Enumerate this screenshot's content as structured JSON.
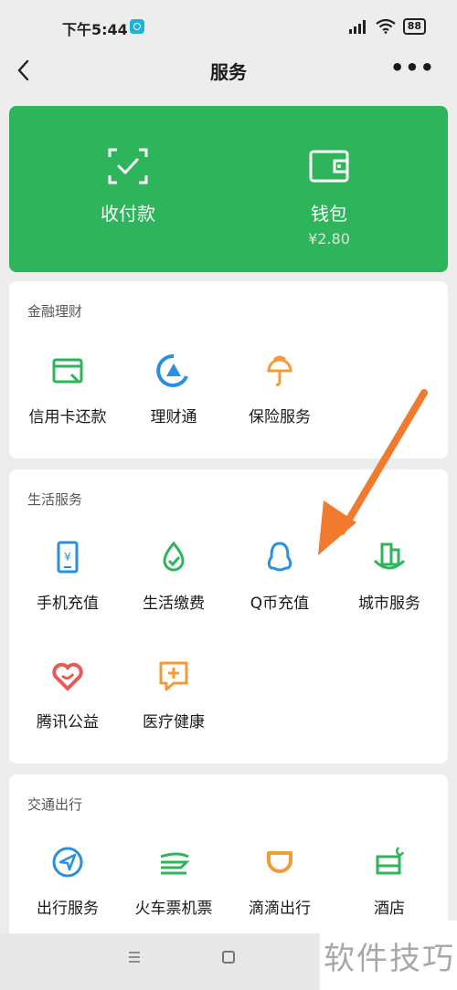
{
  "status_bar": {
    "time": "下午5:44",
    "signal_badge": "HD",
    "battery": "88"
  },
  "header": {
    "title": "服务",
    "more": "•••"
  },
  "wallet_card": {
    "pay_label": "收付款",
    "wallet_label": "钱包",
    "balance": "¥2.80",
    "bg_color": "#2eb45a"
  },
  "sections": {
    "finance": {
      "title": "金融理财",
      "items": [
        {
          "label": "信用卡还款",
          "icon": "credit-card-icon",
          "color": "#2eb45a"
        },
        {
          "label": "理财通",
          "icon": "wealth-icon",
          "color": "#2a8fe0"
        },
        {
          "label": "保险服务",
          "icon": "insurance-icon",
          "color": "#f29b38"
        }
      ]
    },
    "life": {
      "title": "生活服务",
      "items": [
        {
          "label": "手机充值",
          "icon": "phone-recharge-icon",
          "color": "#2a8fe0"
        },
        {
          "label": "生活缴费",
          "icon": "utility-bill-icon",
          "color": "#2eb45a"
        },
        {
          "label": "Q币充值",
          "icon": "qq-penguin-icon",
          "color": "#2a8fe0"
        },
        {
          "label": "城市服务",
          "icon": "city-icon",
          "color": "#2eb45a"
        },
        {
          "label": "腾讯公益",
          "icon": "charity-heart-icon",
          "color": "#e85a5a"
        },
        {
          "label": "医疗健康",
          "icon": "medical-icon",
          "color": "#f29b38"
        }
      ]
    },
    "travel": {
      "title": "交通出行",
      "items": [
        {
          "label": "出行服务",
          "icon": "navigation-icon",
          "color": "#2a8fe0"
        },
        {
          "label": "火车票机票",
          "icon": "train-plane-icon",
          "color": "#2eb45a"
        },
        {
          "label": "滴滴出行",
          "icon": "didi-icon",
          "color": "#f29b38"
        },
        {
          "label": "酒店",
          "icon": "hotel-bed-icon",
          "color": "#2eb45a"
        }
      ]
    }
  },
  "annotation": {
    "arrow_color": "#f07a2e"
  },
  "watermark": {
    "text": "软件技巧"
  }
}
